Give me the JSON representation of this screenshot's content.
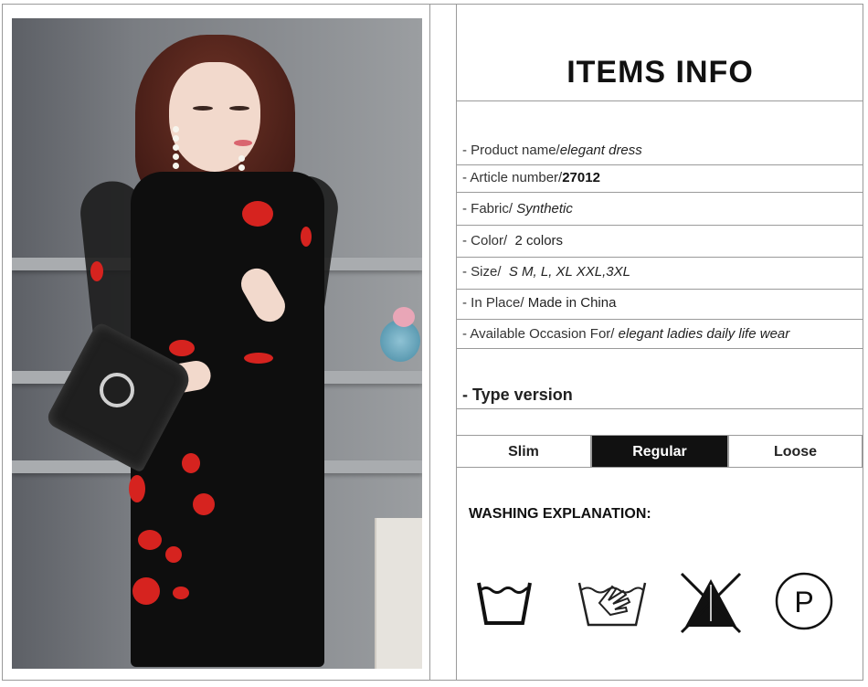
{
  "items_info": {
    "title": "ITEMS INFO"
  },
  "details": [
    {
      "label": "- Product name/",
      "value": "elegant dress"
    },
    {
      "label": "- Article number/",
      "value": "27012"
    },
    {
      "label": "- Fabric/",
      "value": "Synthetic"
    },
    {
      "label": "- Color/",
      "value": "2 colors"
    },
    {
      "label": "- Size/",
      "value": "S M, L, XL XXL,3XL"
    },
    {
      "label": "- In Place/",
      "value": "Made in China"
    },
    {
      "label": "- Available Occasion For/",
      "value": "elegant ladies daily life wear"
    }
  ],
  "type_version": {
    "title": "- Type version",
    "options": [
      "Slim",
      "Regular",
      "Loose"
    ],
    "selected": "Regular"
  },
  "washing": {
    "title": "WASHING EXPLANATION:",
    "icons": [
      "machine-wash-icon",
      "hand-wash-icon",
      "do-not-bleach-icon",
      "dry-clean-p-icon"
    ],
    "dry_clean_letter": "P"
  },
  "colors": {
    "border": "#9a9a9a",
    "selected_bg": "#111111",
    "flower_red": "#d6231f"
  }
}
